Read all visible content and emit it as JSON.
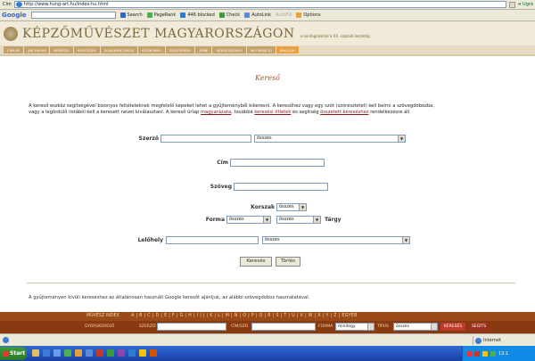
{
  "browser": {
    "address_label": "Cím",
    "url": "http://www.hung-art.hu/index-hu.html",
    "go_label": "Ugrá"
  },
  "google_toolbar": {
    "logo": "Google",
    "search_label": "Search",
    "pagerank_label": "PageRank",
    "blocked_label": "446 blocked",
    "check_label": "Check",
    "autolink_label": "AutoLink",
    "autofill_label": "AutoFill",
    "options_label": "Options"
  },
  "site": {
    "title": "KÉPZŐMŰVÉSZET MAGYARORSZÁGON",
    "subtitle": "a honfoglalástól a XX. századi kezdetig",
    "nav": [
      "CÍMLAP",
      "ARCHÍVUM",
      "KERESÉS",
      "MŰVÉSZEK",
      "DOKUMENTUMOK",
      "KÉZIKÖNYV",
      "GYŰJTEMÉNY",
      "ZENE",
      "VENDÉGKÖNYV",
      "INFORMÁCIÓ",
      "ENGLISH"
    ]
  },
  "page": {
    "search_title": "Kereső",
    "intro_1": "A kereső eszköz segítségével bizonyos feltételeknek megfelelő képeket lehet a gyűjteményből kikeresni. A keresőhez vagy egy szót (szórészletet) kell beírni a szövegdobozba,",
    "intro_2": "vagy a legördülő listából kell a keresett nevet kiválasztani. A kereső ürlap",
    "intro_link_1": "magyarázata",
    "intro_3": ", továbbá",
    "intro_link_2": "keresési ötletek",
    "intro_4": "és segítség",
    "intro_link_3": "összetett kereséshez",
    "intro_5": "rendelkezésre áll.",
    "google_note": "A gyűjteményen kívüli kereséshez az általánosan használt Google keresőt ajánljuk, az alábbi szövegdoboz használatával."
  },
  "form": {
    "author_label": "Szerző",
    "author_select": "összes",
    "title_label": "Cím",
    "text_label": "Szöveg",
    "period_label": "Korszak",
    "period_select": "összes",
    "form_label": "Forma",
    "form_select": "összes",
    "subject_select": "összes",
    "subject_label": "Tárgy",
    "location_label": "Lelőhely",
    "location_select": "összes",
    "search_button": "Keresés",
    "clear_button": "Törlés"
  },
  "bottom": {
    "artists_label": "MŰVÉSZ INDEX",
    "letters": "A | B | C | D | E | F | G | H | I | J | K | L | M | N | O | P | Q | R | S | T | U | V | W | X | Y | Z | EGYÉB",
    "quick_label": "GYORSKERESŐ",
    "author_short": "SZERZŐ",
    "title_short": "CÍM/SZÓ",
    "form_short": "FORMA",
    "form_select": "mindegy",
    "type_short": "TÍPUS",
    "type_select": "összes",
    "go_label": "KERESÉS",
    "help_label": "SEGÍTS"
  },
  "status": {
    "zone": "Internet"
  },
  "taskbar": {
    "start": "Start",
    "clock": "13:1"
  },
  "colors": {
    "header_bg": "#f1ead9",
    "nav_item": "#c4a26a",
    "nav_active": "#e8a040",
    "title_brown": "#7a6a3c",
    "link": "#8b1a1a",
    "alpha_bar": "#9b4b18",
    "quicksearch_bar": "#8a3a10"
  }
}
